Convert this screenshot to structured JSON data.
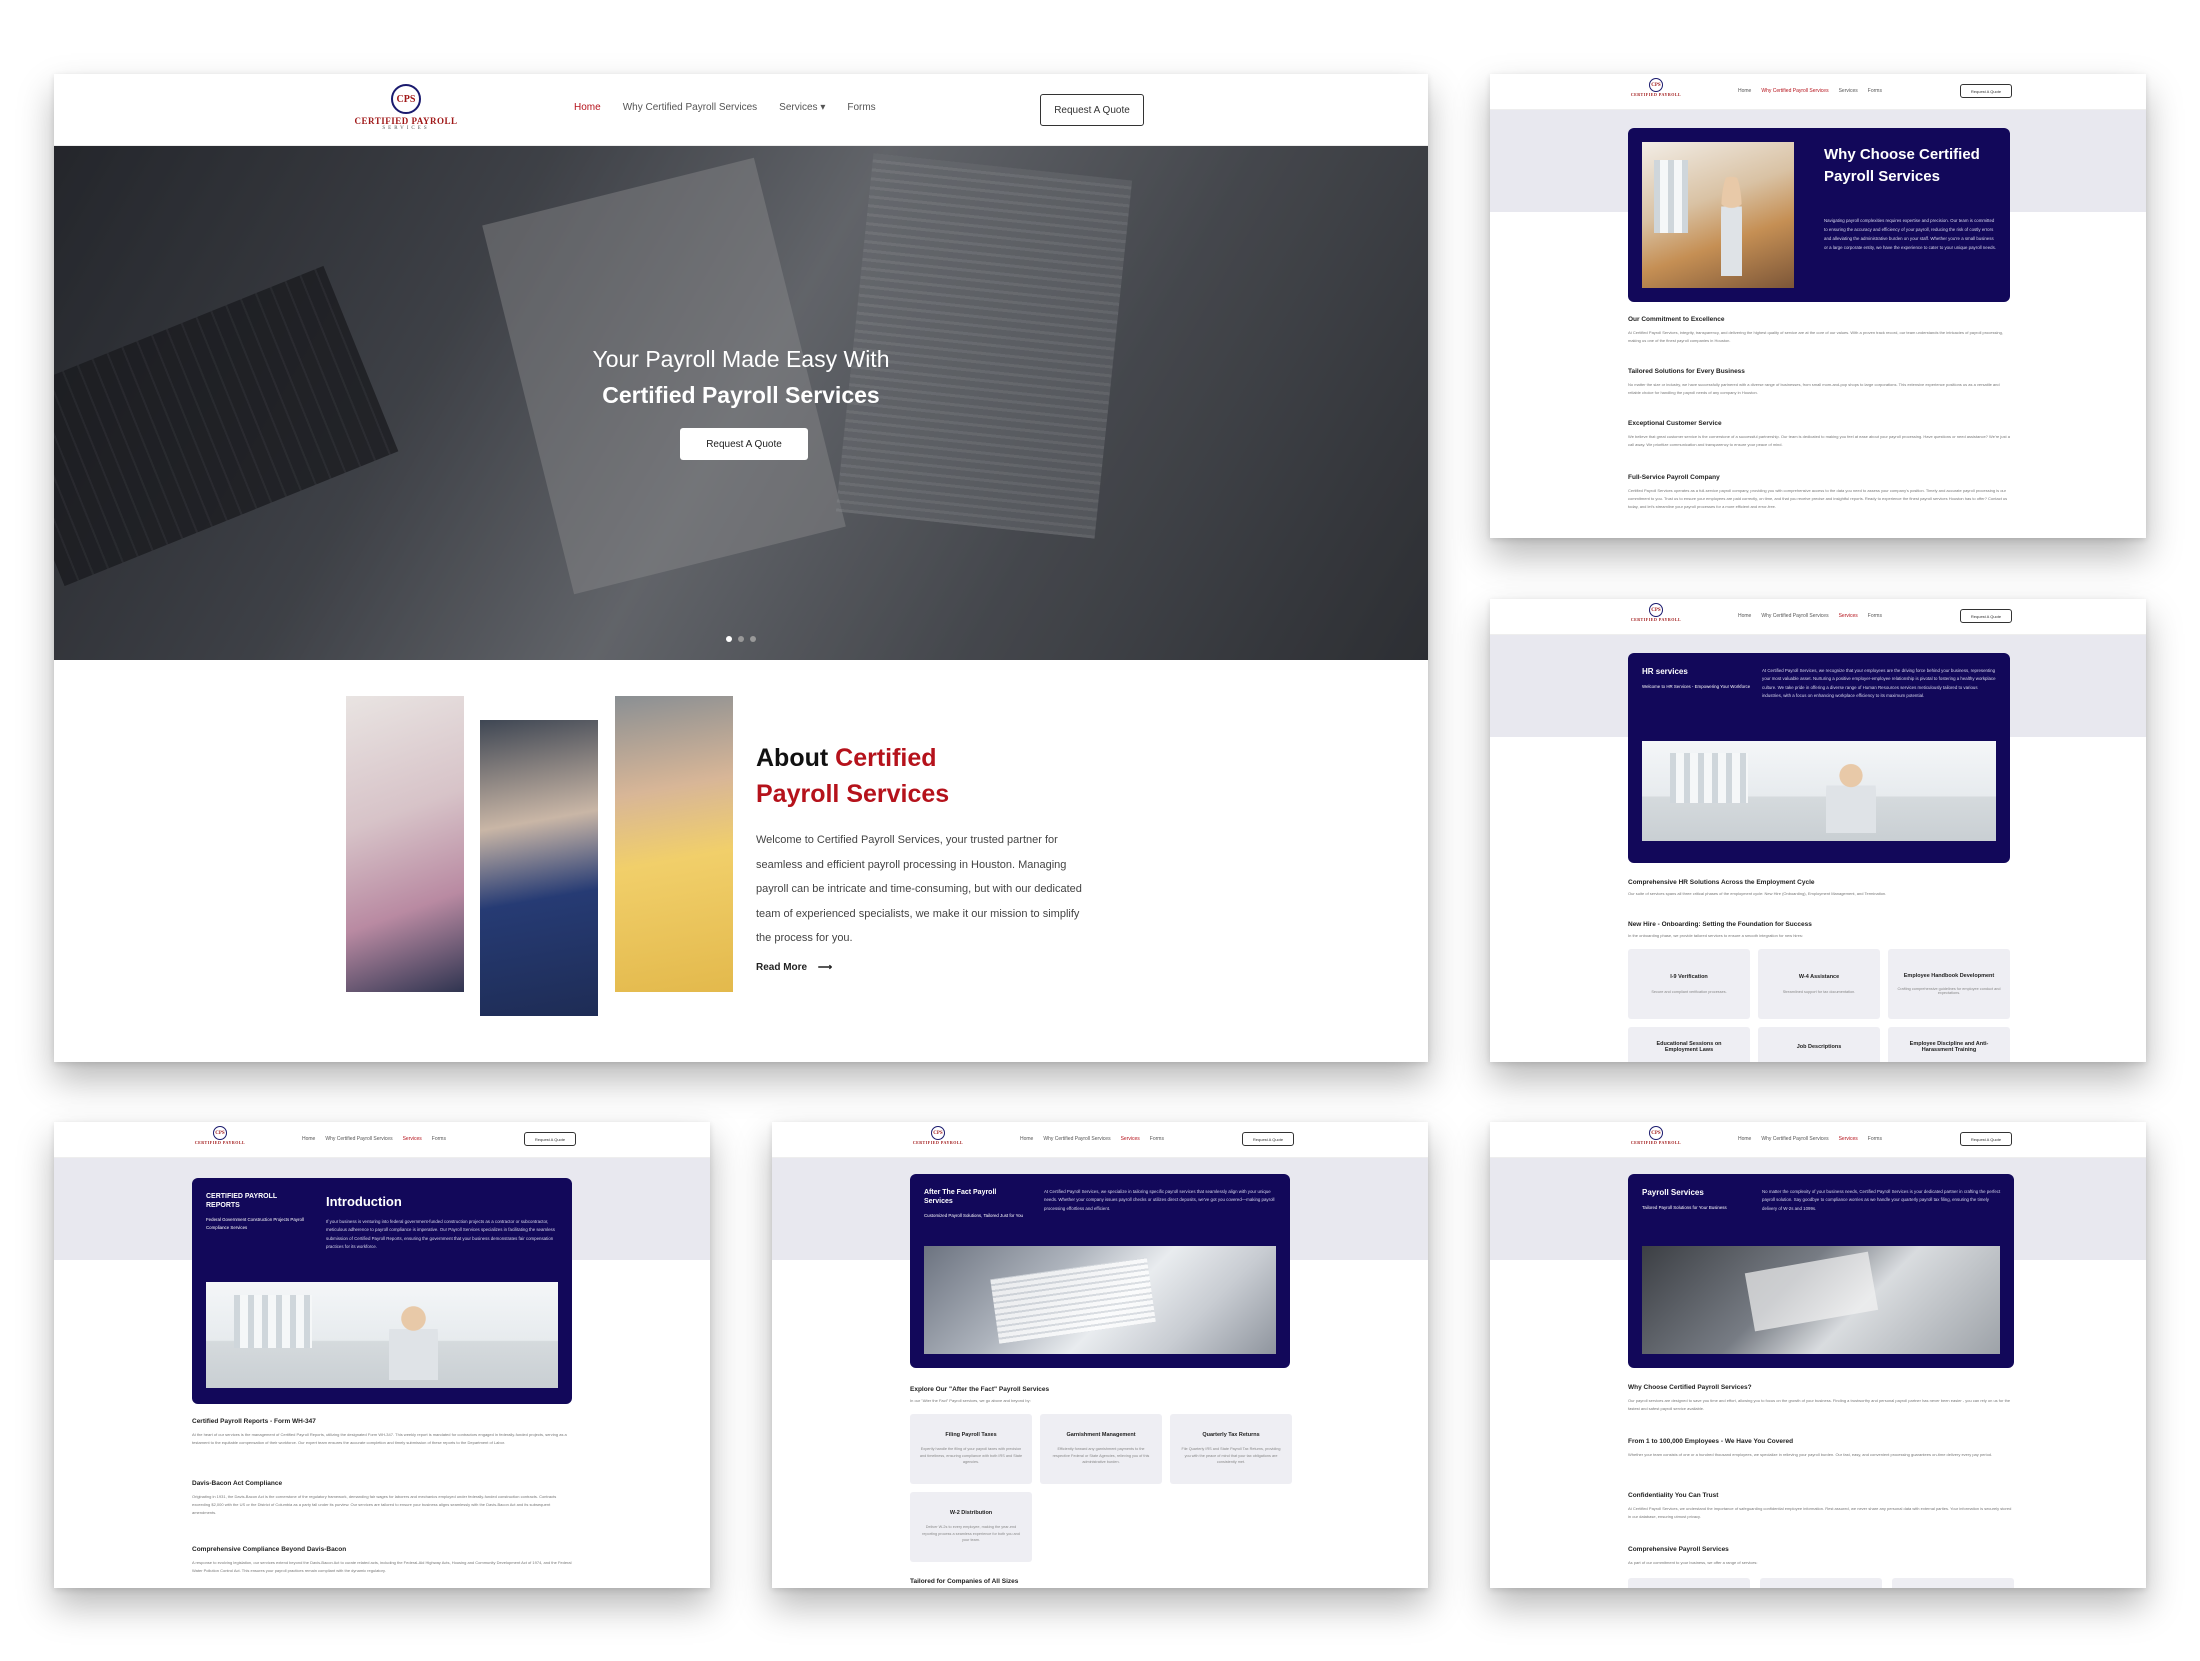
{
  "brand": {
    "monogram": "CPS",
    "name": "CERTIFIED PAYROLL",
    "sub": "SERVICES"
  },
  "nav": {
    "home": "Home",
    "why": "Why Certified Payroll Services",
    "services": "Services",
    "forms": "Forms",
    "quote": "Request A Quote"
  },
  "icons": {
    "caret": "caret-down-icon",
    "arrow": "arrow-right-icon"
  },
  "colors": {
    "accent": "#b5121b",
    "navy": "#12085a"
  },
  "hero": {
    "line1": "Your Payroll Made Easy With",
    "line2": "Certified Payroll Services",
    "button": "Request A Quote",
    "slides_total": 3,
    "active_slide": 1
  },
  "about": {
    "title_a": "About ",
    "title_b": "Certified",
    "title_c": "Payroll Services",
    "body": "Welcome to Certified Payroll Services, your trusted partner for seamless and efficient payroll processing in Houston. Managing payroll can be intricate and time-consuming, but with our dedicated team of experienced specialists, we make it our mission to simplify the process for you.",
    "link": "Read More"
  },
  "why": {
    "card_title": "Why Choose Certified Payroll Services",
    "card_body": "Navigating payroll complexities requires expertise and precision. Our team is committed to ensuring the accuracy and efficiency of your payroll, reducing the risk of costly errors and alleviating the administrative burden on your staff. Whether you're a small business or a large corporate entity, we have the experience to cater to your unique payroll needs.",
    "sections": [
      {
        "h": "Our Commitment to Excellence",
        "p": "At Certified Payroll Services, integrity, transparency, and delivering the highest quality of service are at the core of our values. With a proven track record, our team understands the intricacies of payroll processing, making us one of the finest payroll companies in Houston."
      },
      {
        "h": "Tailored Solutions for Every Business",
        "p": "No matter the size or industry, we have successfully partnered with a diverse range of businesses, from small mom-and-pop shops to large corporations. This extensive experience positions us as a versatile and reliable choice for handling the payroll needs of any company in Houston."
      },
      {
        "h": "Exceptional Customer Service",
        "p": "We believe that great customer service is the cornerstone of a successful partnership. Our team is dedicated to making you feel at ease about your payroll processing. Have questions or need assistance? We're just a call away. We prioritize communication and transparency to ensure your peace of mind."
      },
      {
        "h": "Full-Service Payroll Company",
        "p": "Certified Payroll Services operates as a full-service payroll company, providing you with comprehensive access to the data you need to assess your company's position. Timely and accurate payroll processing is our commitment to you. Trust us to ensure your employees are paid correctly, on time, and that you receive precise and insightful reports. Ready to experience the finest payroll services Houston has to offer? Contact us today, and let's streamline your payroll processes for a more efficient and error-free."
      }
    ]
  },
  "hr": {
    "card_title": "HR services",
    "card_sub": "Welcome to HR Services - Empowering Your Workforce",
    "card_body": "At Certified Payroll Services, we recognize that your employees are the driving force behind your business, representing your most valuable asset. Nurturing a positive employer-employee relationship is pivotal to fostering a healthy workplace culture. We take pride in offering a diverse range of Human Resources services meticulously tailored to various industries, with a focus on enhancing workplace efficiency to its maximum potential.",
    "s1_h": "Comprehensive HR Solutions Across the Employment Cycle",
    "s1_p": "Our suite of services spans all three critical phases of the employment cycle: New Hire (Onboarding), Employment Management, and Termination.",
    "s2_h": "New Hire - Onboarding: Setting the Foundation for Success",
    "s2_p": "In the onboarding phase, we provide tailored services to ensure a smooth integration for new hires:",
    "tiles": [
      {
        "t": "I-9 Verification",
        "d": "Secure and compliant verification processes."
      },
      {
        "t": "W-4 Assistance",
        "d": "Streamlined support for tax documentation."
      },
      {
        "t": "Employee Handbook Development",
        "d": "Crafting comprehensive guidelines for employee conduct and expectations."
      },
      {
        "t": "Educational Sessions on Employment Laws",
        "d": ""
      },
      {
        "t": "Job Descriptions",
        "d": ""
      },
      {
        "t": "Employee Discipline and Anti-Harassment Training",
        "d": ""
      }
    ]
  },
  "cpr": {
    "card_title": "CERTIFIED PAYROLL REPORTS",
    "card_sub": "Federal Government Construction Projects Payroll Compliance Services",
    "intro_h": "Introduction",
    "intro_p": "If your business is venturing into federal government-funded construction projects as a contractor or subcontractor, meticulous adherence to payroll compliance is imperative. Our Payroll Services specializes in facilitating the seamless submission of Certified Payroll Reports, ensuring the government that your business demonstrates fair compensation practices for its workforce.",
    "sections": [
      {
        "h": "Certified Payroll Reports - Form WH-347",
        "p": "At the heart of our services is the management of Certified Payroll Reports, utilizing the designated Form WH-347. This weekly report is mandated for contractors engaged in federally-funded projects, serving as a testament to the equitable compensation of their workforce. Our expert team ensures the accurate completion and timely submission of these reports to the Department of Labor."
      },
      {
        "h": "Davis-Bacon Act Compliance",
        "p": "Originating in 1931, the Davis-Bacon Act is the cornerstone of the regulatory framework, demanding fair wages for laborers and mechanics employed under federally-funded construction contracts. Contracts exceeding $2,000 with the US or the District of Columbia as a party fall under its purview. Our services are tailored to ensure your business aligns seamlessly with the Davis-Bacon Act and its subsequent amendments."
      },
      {
        "h": "Comprehensive Compliance Beyond Davis-Bacon",
        "p": "A response to evolving legislation, our services extend beyond the Davis-Bacon Act to curate related acts, including the Federal-Aid Highway Acts, Housing and Community Development Act of 1974, and the Federal Water Pollution Control Act. This ensures your payroll practices remain compliant with the dynamic regulatory."
      }
    ]
  },
  "atf": {
    "card_title": "After The Fact Payroll Services",
    "card_sub": "Customized Payroll Solutions, Tailored Just for You",
    "card_body": "At Certified Payroll Services, we specialize in tailoring specific payroll services that seamlessly align with your unique needs. Whether your company issues payroll checks or utilizes direct deposits, we've got you covered—making payroll processing effortless and efficient.",
    "s1_h": "Explore Our \"After the Fact\" Payroll Services",
    "s1_p": "In our \"After the Fact\" Payroll services, we go above and beyond by:",
    "tiles": [
      {
        "t": "Filing Payroll Taxes",
        "d": "Expertly handle the filing of your payroll taxes with precision and timeliness, ensuring compliance with both IRS and State agencies."
      },
      {
        "t": "Garnishment Management",
        "d": "Efficiently forward any garnishment payments to the respective Federal or State Agencies, relieving you of this administrative burden."
      },
      {
        "t": "Quarterly Tax Returns",
        "d": "File Quarterly IRS and State Payroll Tax Returns, providing you with the peace of mind that your tax obligations are consistently met."
      },
      {
        "t": "W-2 Distribution",
        "d": "Deliver W-2s to every employee, making the year-end reporting process a seamless experience for both you and your team."
      }
    ],
    "s2_h": "Tailored for Companies of All Sizes"
  },
  "ps": {
    "card_title": "Payroll Services",
    "card_sub": "Tailored Payroll Solutions for Your Business",
    "card_body": "No matter the complexity of your business needs, Certified Payroll Services is your dedicated partner in crafting the perfect payroll solution. Say goodbye to compliance worries as we handle your quarterly payroll tax filing, ensuring the timely delivery of W-2s and 1099s.",
    "sections": [
      {
        "h": "Why Choose Certified Payroll Services?",
        "p": "Our payroll services are designed to save you time and effort, allowing you to focus on the growth of your business. Finding a trustworthy and personal payroll partner has never been easier - you can rely on us for the fastest and safest payroll service available."
      },
      {
        "h": "From 1 to 100,000 Employees - We Have You Covered",
        "p": "Whether your team consists of one or a hundred thousand employees, we specialize in relieving your payroll burden. Our fast, easy, and convenient processing guarantees on-time delivery every pay period."
      },
      {
        "h": "Confidentiality You Can Trust",
        "p": "At Certified Payroll Services, we understand the importance of safeguarding confidential employee information. Rest assured, we never share any personal data with external parties. Your information is securely stored in our database, ensuring utmost privacy."
      },
      {
        "h": "Comprehensive Payroll Services",
        "p": "As part of our commitment to your business, we offer a range of services:"
      }
    ]
  }
}
